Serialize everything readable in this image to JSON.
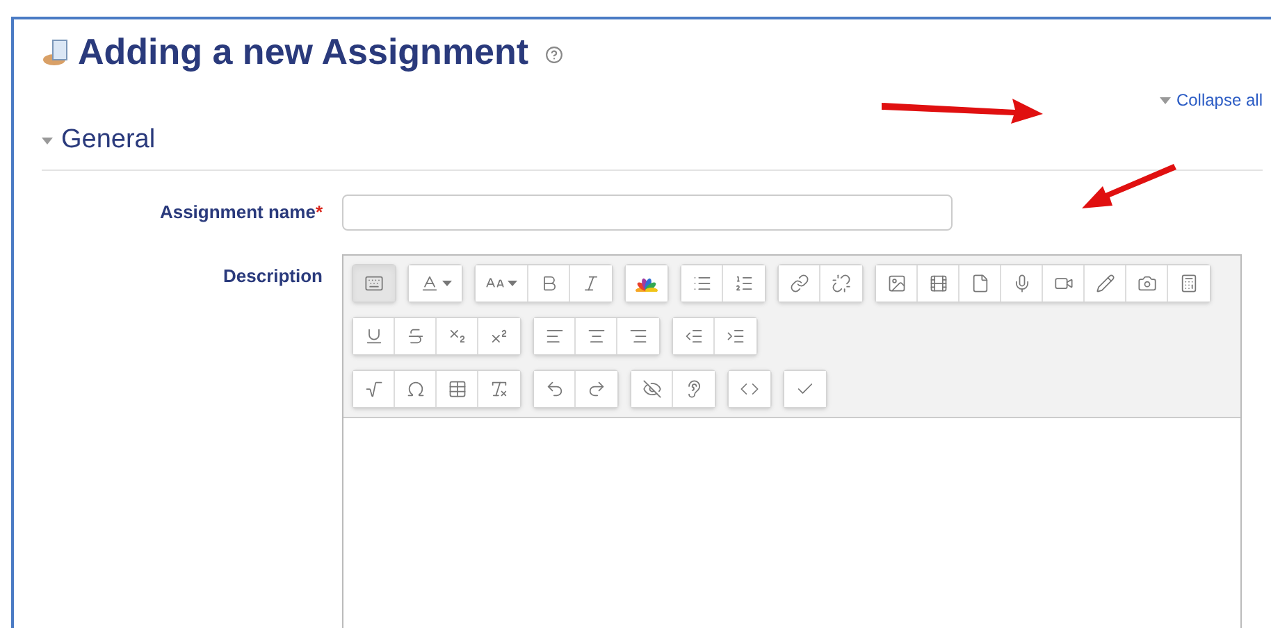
{
  "page": {
    "title": "Adding a new Assignment",
    "collapse_link": "Collapse all"
  },
  "section": {
    "title": "General",
    "expanded": true
  },
  "form": {
    "name_label": "Assignment name",
    "required_mark": "*",
    "description_label": "Description"
  },
  "toolbar_rows": [
    [
      [
        {
          "kind": "toggle",
          "pressed": true
        }
      ],
      [
        {
          "kind": "fontcolor",
          "pressed": false
        }
      ],
      [
        {
          "kind": "fontsize",
          "pressed": false
        },
        {
          "kind": "bold",
          "pressed": false
        },
        {
          "kind": "italic",
          "pressed": false
        }
      ],
      [
        {
          "kind": "colors",
          "pressed": false
        }
      ],
      [
        {
          "kind": "bullets",
          "pressed": false
        },
        {
          "kind": "numbers",
          "pressed": false
        }
      ],
      [
        {
          "kind": "link",
          "pressed": false
        },
        {
          "kind": "unlink",
          "pressed": false
        }
      ],
      [
        {
          "kind": "image",
          "pressed": false
        },
        {
          "kind": "media",
          "pressed": false
        },
        {
          "kind": "file",
          "pressed": false
        },
        {
          "kind": "mic",
          "pressed": false
        },
        {
          "kind": "video",
          "pressed": false
        },
        {
          "kind": "pencil",
          "pressed": false
        },
        {
          "kind": "camera",
          "pressed": false
        },
        {
          "kind": "calc",
          "pressed": false
        }
      ]
    ],
    [
      [
        {
          "kind": "underline",
          "pressed": false
        },
        {
          "kind": "strike",
          "pressed": false
        },
        {
          "kind": "sub",
          "pressed": false
        },
        {
          "kind": "sup",
          "pressed": false
        }
      ],
      [
        {
          "kind": "alignleft",
          "pressed": false
        },
        {
          "kind": "aligncenter",
          "pressed": false
        },
        {
          "kind": "alignright",
          "pressed": false
        }
      ],
      [
        {
          "kind": "outdent",
          "pressed": false
        },
        {
          "kind": "indent",
          "pressed": false
        }
      ]
    ],
    [
      [
        {
          "kind": "sqrt",
          "pressed": false
        },
        {
          "kind": "omega",
          "pressed": false
        },
        {
          "kind": "table",
          "pressed": false
        },
        {
          "kind": "clear",
          "pressed": false
        }
      ],
      [
        {
          "kind": "undo",
          "pressed": false
        },
        {
          "kind": "redo",
          "pressed": false
        }
      ],
      [
        {
          "kind": "eyeoff",
          "pressed": false
        },
        {
          "kind": "ear",
          "pressed": false
        }
      ],
      [
        {
          "kind": "code",
          "pressed": false
        }
      ],
      [
        {
          "kind": "check",
          "pressed": false
        }
      ]
    ]
  ]
}
